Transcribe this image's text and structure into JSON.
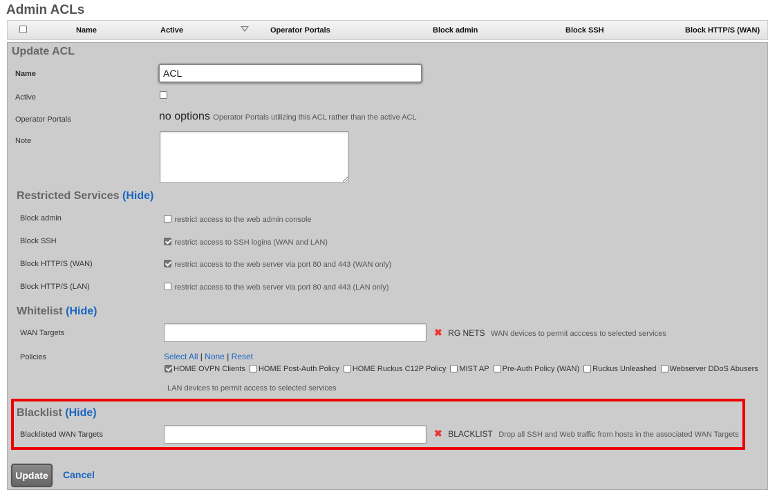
{
  "page": {
    "title": "Admin ACLs"
  },
  "table_header": {
    "columns": [
      "Name",
      "Active",
      "Operator Portals",
      "Block admin",
      "Block SSH",
      "Block HTTP/S (WAN)"
    ]
  },
  "form": {
    "title": "Update ACL",
    "name_label": "Name",
    "name_value": "ACL",
    "active_label": "Active",
    "active_checked": false,
    "operator_portals_label": "Operator Portals",
    "operator_portals_value": "no options",
    "operator_portals_help": "Operator Portals utilizing this ACL rather than the active ACL",
    "note_label": "Note",
    "note_value": ""
  },
  "restricted_services": {
    "title": "Restricted Services",
    "hide_label": "(Hide)",
    "items": [
      {
        "label": "Block admin",
        "checked": false,
        "help": "restrict access to the web admin console"
      },
      {
        "label": "Block SSH",
        "checked": true,
        "help": "restrict access to SSH logins (WAN and LAN)"
      },
      {
        "label": "Block HTTP/S (WAN)",
        "checked": true,
        "help": "restrict access to the web server via port 80 and 443 (WAN only)"
      },
      {
        "label": "Block HTTP/S (LAN)",
        "checked": false,
        "help": "restrict access to the web server via port 80 and 443 (LAN only)"
      }
    ]
  },
  "whitelist": {
    "title": "Whitelist",
    "hide_label": "(Hide)",
    "wan_targets_label": "WAN Targets",
    "wan_targets_value": "",
    "wan_tag": "RG NETS",
    "wan_help": "WAN devices to permit acccess to selected services",
    "policies_label": "Policies",
    "select_all": "Select All",
    "none": "None",
    "reset": "Reset",
    "separator": "|",
    "policies": [
      {
        "label": "HOME OVPN Clients",
        "checked": true
      },
      {
        "label": "HOME Post-Auth Policy",
        "checked": false
      },
      {
        "label": "HOME Ruckus C12P Policy",
        "checked": false
      },
      {
        "label": "MIST AP",
        "checked": false
      },
      {
        "label": "Pre-Auth Policy (WAN)",
        "checked": false
      },
      {
        "label": "Ruckus Unleashed",
        "checked": false
      },
      {
        "label": "Webserver DDoS Abusers",
        "checked": false
      }
    ],
    "policies_help": "LAN devices to permit access to selected services"
  },
  "blacklist": {
    "title": "Blacklist",
    "hide_label": "(Hide)",
    "targets_label": "Blacklisted WAN Targets",
    "targets_value": "",
    "tag": "BLACKLIST",
    "help": "Drop all SSH and Web traffic from hosts in the associated WAN Targets"
  },
  "actions": {
    "update": "Update",
    "cancel": "Cancel"
  }
}
